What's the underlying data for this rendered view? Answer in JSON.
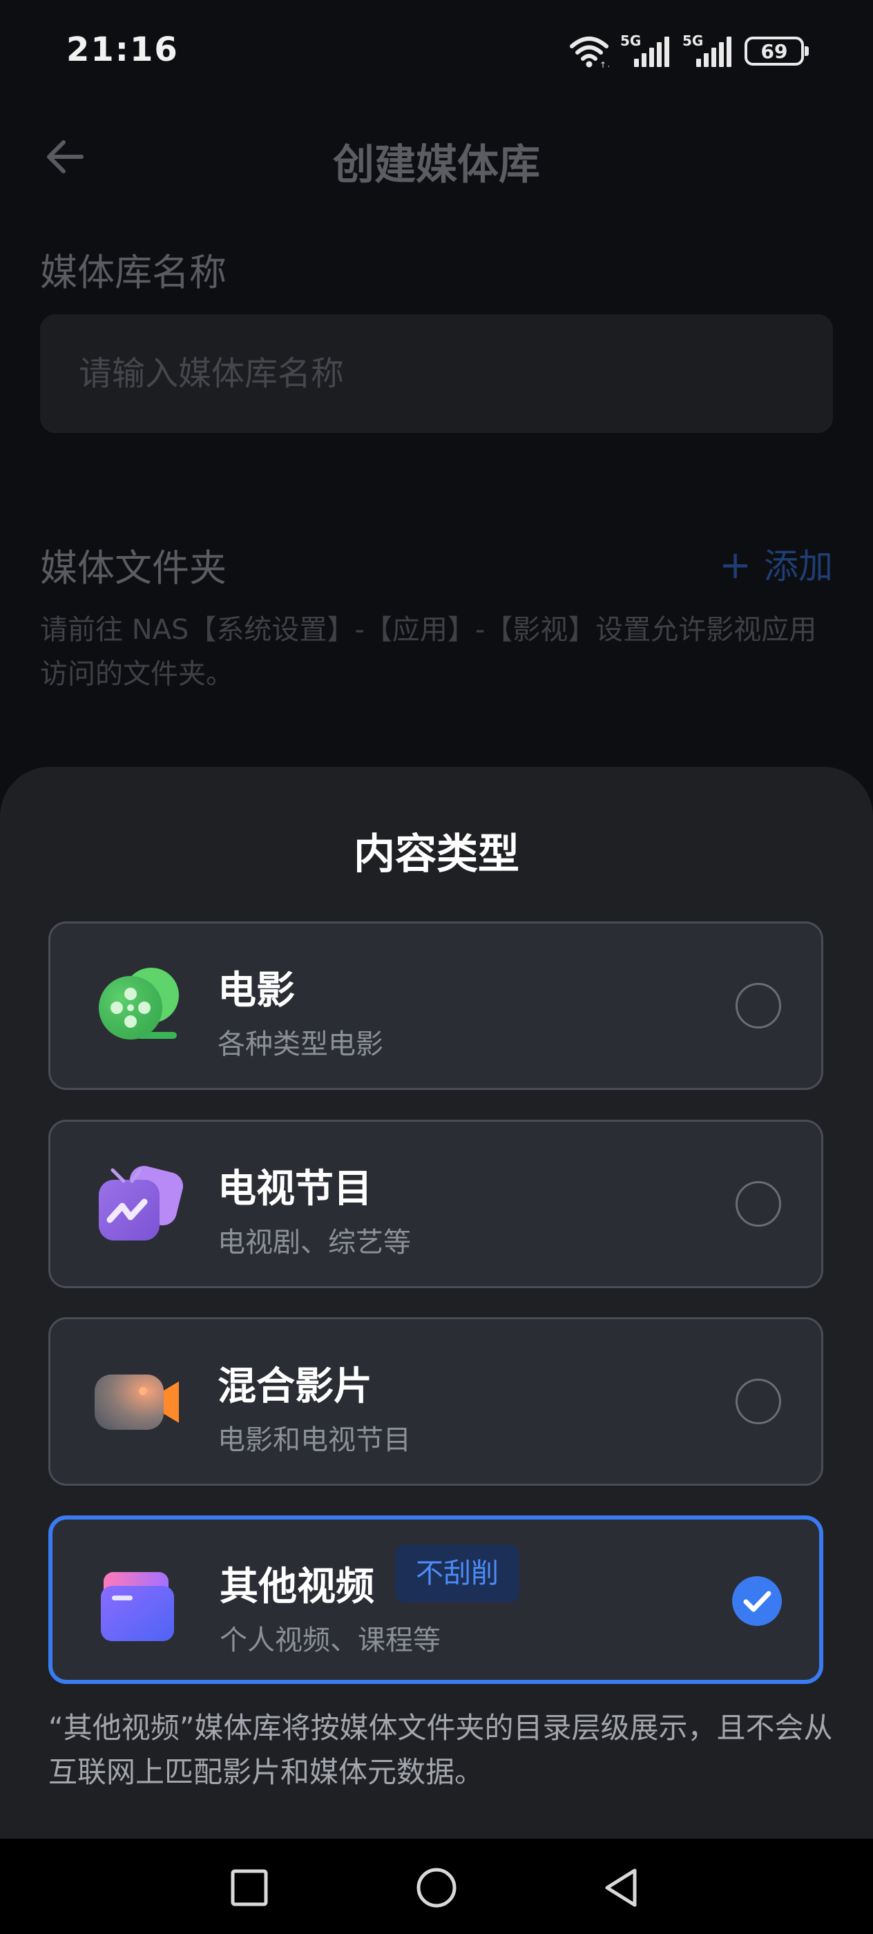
{
  "status_bar": {
    "time": "21:16",
    "sim1_label": "5G",
    "sim2_label": "5G",
    "battery": "69",
    "icons": [
      "wifi-icon",
      "signal-icon",
      "signal-icon",
      "battery-icon"
    ]
  },
  "page": {
    "title": "创建媒体库",
    "name_label": "媒体库名称",
    "name_placeholder": "请输入媒体库名称",
    "name_value": "",
    "folder_label": "媒体文件夹",
    "add_label": "添加",
    "folder_hint": "请前往 NAS【系统设置】-【应用】-【影视】设置允许影视应用访问的文件夹。"
  },
  "sheet": {
    "title": "内容类型",
    "options": [
      {
        "title": "电影",
        "subtitle": "各种类型电影",
        "icon": "film-reel-icon",
        "selected": false
      },
      {
        "title": "电视节目",
        "subtitle": "电视剧、综艺等",
        "icon": "tv-icon",
        "selected": false
      },
      {
        "title": "混合影片",
        "subtitle": "电影和电视节目",
        "icon": "video-camera-icon",
        "selected": false
      },
      {
        "title": "其他视频",
        "subtitle": "个人视频、课程等",
        "icon": "folder-icon",
        "badge": "不刮削",
        "selected": true
      }
    ],
    "note": "“其他视频”媒体库将按媒体文件夹的目录层级展示，且不会从互联网上匹配影片和媒体元数据。"
  },
  "nav": {
    "icons": [
      "recent-apps-icon",
      "home-icon",
      "back-icon"
    ]
  },
  "colors": {
    "accent": "#3a7bf2",
    "sheet_bg": "#1f2024",
    "card_bg": "#2b2d34",
    "badge_bg": "#1b2f57",
    "badge_text": "#4c8cf7"
  }
}
